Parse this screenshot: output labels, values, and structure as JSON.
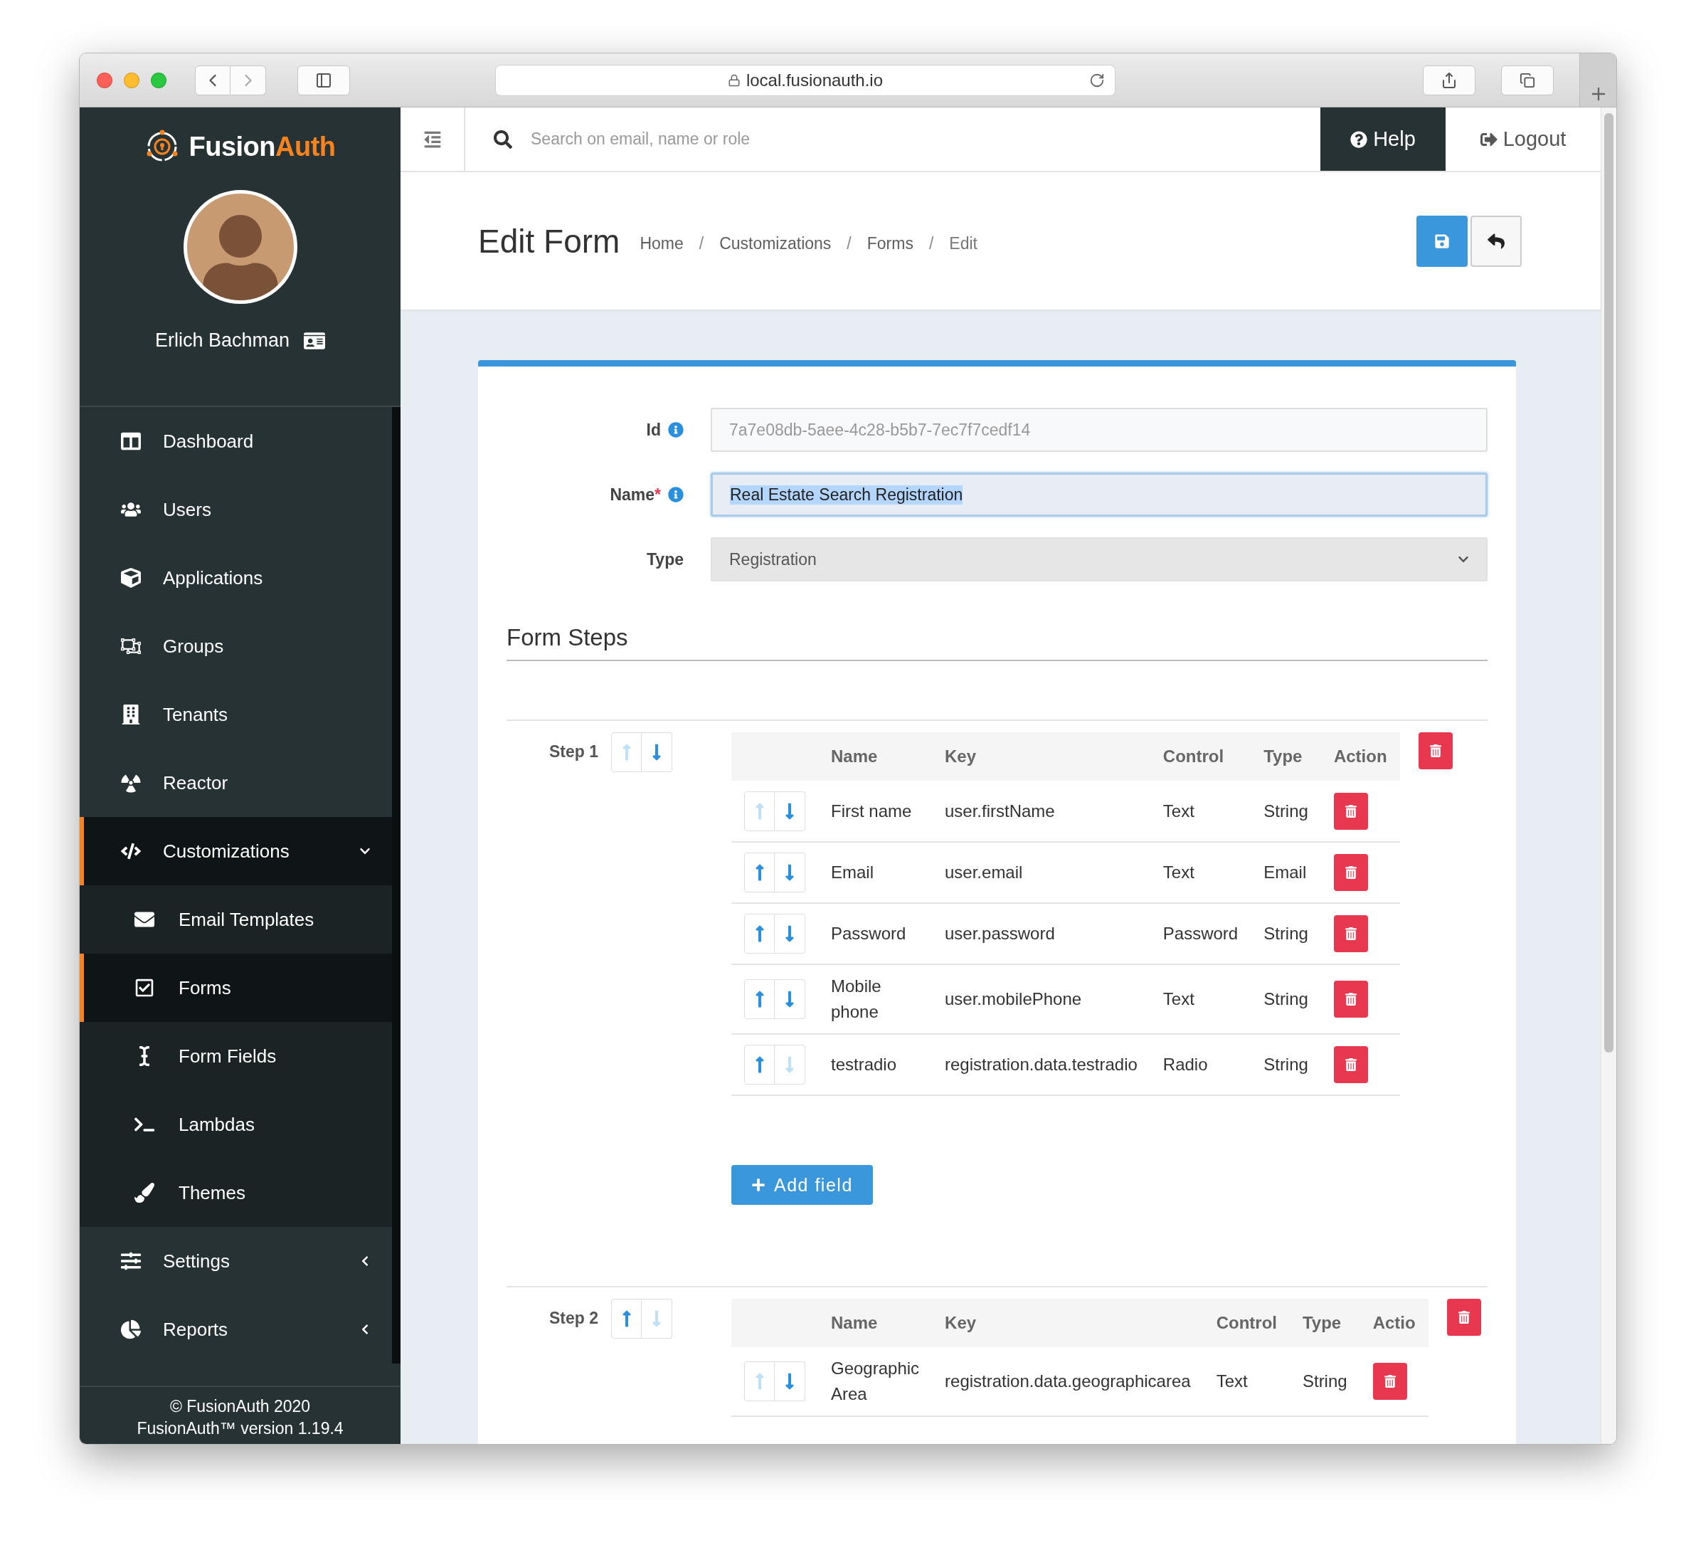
{
  "browser": {
    "url": "local.fusionauth.io"
  },
  "sidebar": {
    "logo": [
      "Fusion",
      "Auth"
    ],
    "user": {
      "name": "Erlich Bachman"
    },
    "nav": [
      {
        "label": "Dashboard",
        "selected": false
      },
      {
        "label": "Users",
        "selected": false
      },
      {
        "label": "Applications",
        "selected": false
      },
      {
        "label": "Groups",
        "selected": false
      },
      {
        "label": "Tenants",
        "selected": false
      },
      {
        "label": "Reactor",
        "selected": false
      },
      {
        "label": "Customizations",
        "selected": true,
        "expanded": true,
        "children": [
          {
            "label": "Email Templates",
            "selected": false
          },
          {
            "label": "Forms",
            "selected": true
          },
          {
            "label": "Form Fields",
            "selected": false
          },
          {
            "label": "Lambdas",
            "selected": false
          },
          {
            "label": "Themes",
            "selected": false
          }
        ]
      },
      {
        "label": "Settings",
        "selected": false,
        "expanded": false
      },
      {
        "label": "Reports",
        "selected": false,
        "expanded": false
      }
    ],
    "footer": [
      "© FusionAuth 2020",
      "FusionAuth™ version 1.19.4"
    ]
  },
  "topbar": {
    "search": {
      "placeholder": "Search on email, name or role"
    },
    "help": "Help",
    "logout": "Logout"
  },
  "page": {
    "title": "Edit Form",
    "breadcrumbs": [
      {
        "kind": "link",
        "text": "Home"
      },
      {
        "kind": "separator",
        "text": "/"
      },
      {
        "kind": "link",
        "text": "Customizations"
      },
      {
        "kind": "separator",
        "text": "/"
      },
      {
        "kind": "link",
        "text": "Forms"
      },
      {
        "kind": "separator",
        "text": "/"
      },
      {
        "kind": "current",
        "text": "Edit"
      }
    ]
  },
  "form": {
    "fields": [
      {
        "kind": "readonly",
        "label": "Id",
        "info": true,
        "value": "7a7e08db-5aee-4c28-b5b7-7ec7f7cedf14",
        "focused": false,
        "text_selected": false
      },
      {
        "kind": "text",
        "label": "Name",
        "mark": "*",
        "info": true,
        "value": "Real Estate Search Registration",
        "focused": true,
        "text_selected": true
      },
      {
        "kind": "select",
        "label": "Type",
        "info": false,
        "value": "Registration",
        "focused": false,
        "text_selected": false
      }
    ]
  },
  "form_steps": {
    "title": "Form Steps",
    "steps": [
      {
        "label": "Step 1",
        "up_enabled": false,
        "down_enabled": true,
        "columns": [
          "Name",
          "Key",
          "Control",
          "Type",
          "Action"
        ],
        "add_button": "Add field",
        "rows": [
          {
            "name": "First name",
            "key": "user.firstName",
            "control": "Text",
            "type": "String",
            "up_enabled": false,
            "down_enabled": true
          },
          {
            "name": "Email",
            "key": "user.email",
            "control": "Text",
            "type": "Email",
            "up_enabled": true,
            "down_enabled": true
          },
          {
            "name": "Password",
            "key": "user.password",
            "control": "Password",
            "type": "String",
            "up_enabled": true,
            "down_enabled": true
          },
          {
            "name": "Mobile phone",
            "key": "user.mobilePhone",
            "control": "Text",
            "type": "String",
            "up_enabled": true,
            "down_enabled": true
          },
          {
            "name": "testradio",
            "key": "registration.data.testradio",
            "control": "Radio",
            "type": "String",
            "up_enabled": true,
            "down_enabled": false
          }
        ]
      },
      {
        "label": "Step 2",
        "up_enabled": true,
        "down_enabled": false,
        "columns": [
          "Name",
          "Key",
          "Control",
          "Type",
          "Actio"
        ],
        "rows": [
          {
            "name": "Geographic Area",
            "key": "registration.data.geographicarea",
            "control": "Text",
            "type": "String",
            "up_enabled": false,
            "down_enabled": true
          }
        ]
      }
    ]
  }
}
